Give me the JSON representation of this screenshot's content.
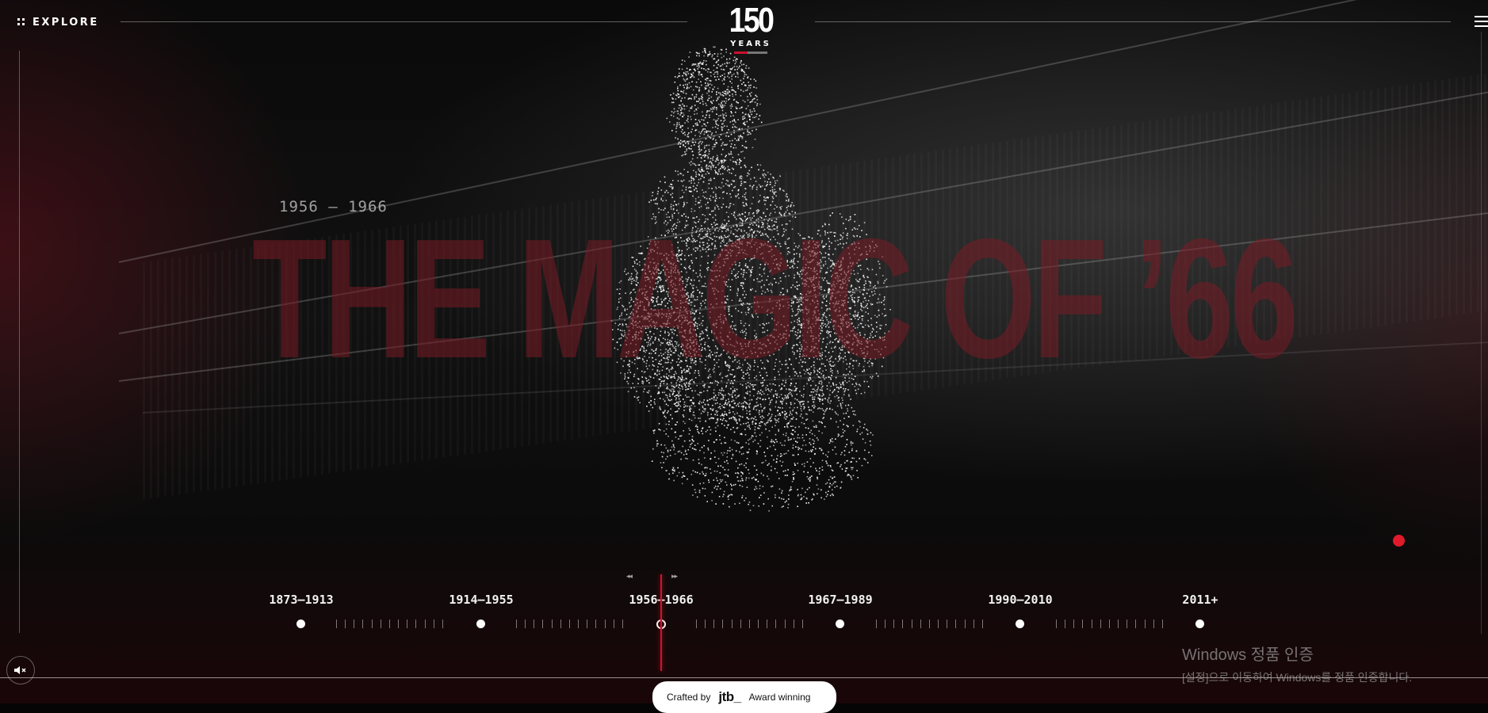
{
  "topbar": {
    "explore_label": "EXPLORE"
  },
  "logo": {
    "number": "150",
    "years": "YEARS"
  },
  "hero": {
    "era_range": "1956 – 1966",
    "headline": "THE MAGIC OF ’66"
  },
  "timeline": {
    "eras": [
      {
        "label": "1873–1913"
      },
      {
        "label": "1914–1955"
      },
      {
        "label": "1956–1966"
      },
      {
        "label": "1967–1989"
      },
      {
        "label": "1990–2010"
      },
      {
        "label": "2011+"
      }
    ],
    "active_index": 2,
    "prev_glyph": "◂◂",
    "next_glyph": "▸▸"
  },
  "footer": {
    "crafted_by": "Crafted by",
    "brand": "jtb_",
    "award": "Award winning"
  },
  "windows_watermark": {
    "title": "Windows 정품 인증",
    "subtitle": "[설정]으로 이동하여 Windows를 정품 인증합니다."
  },
  "colors": {
    "accent": "#d0142a",
    "headline": "#7a1c24",
    "background": "#050505"
  }
}
